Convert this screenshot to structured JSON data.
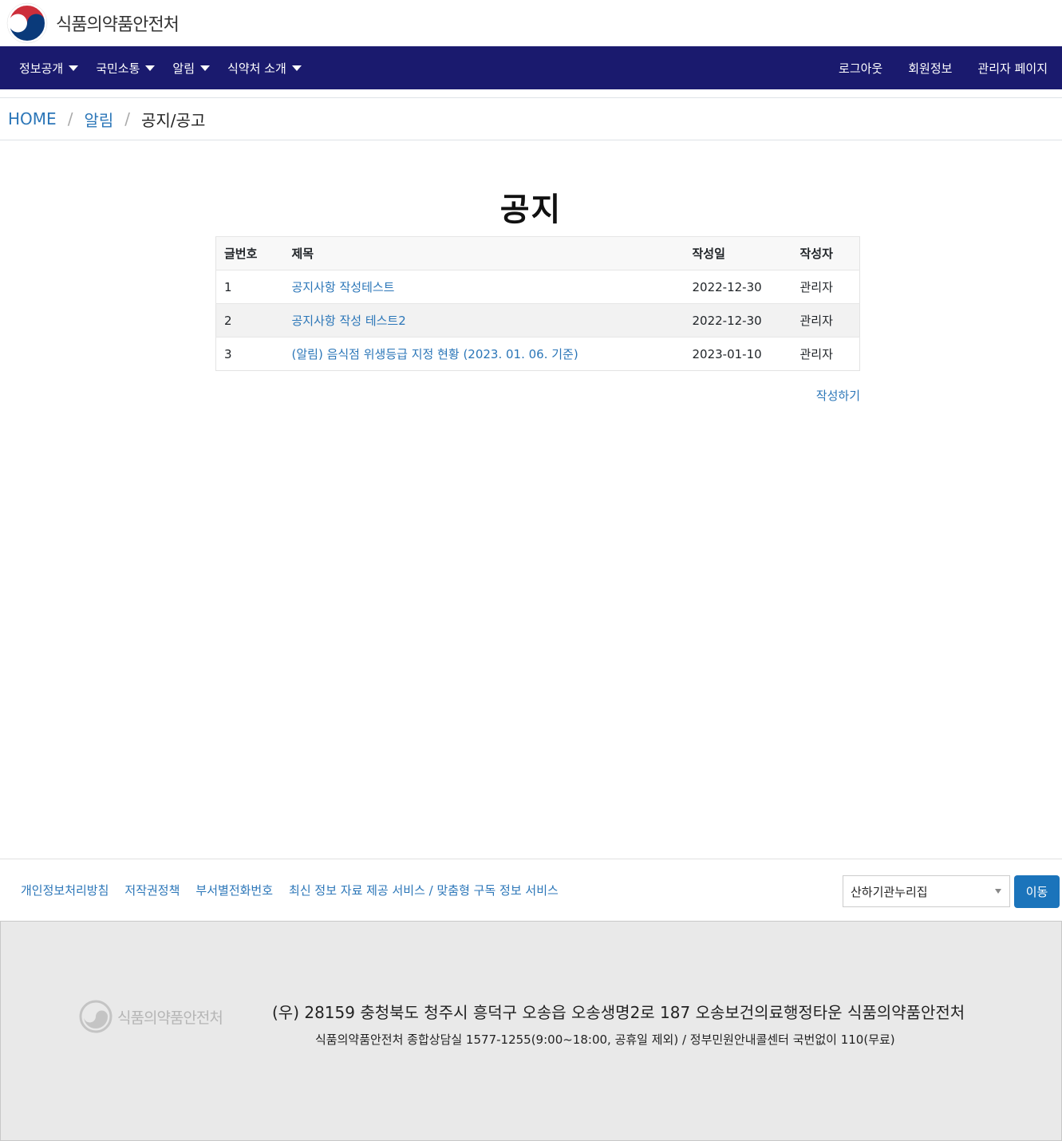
{
  "header": {
    "brand": "식품의약품안전처",
    "nav_left": [
      "정보공개",
      "국민소통",
      "알림",
      "식약처 소개"
    ],
    "nav_right": [
      "로그아웃",
      "회원정보",
      "관리자 페이지"
    ]
  },
  "breadcrumb": {
    "home": "HOME",
    "section": "알림",
    "current": "공지/공고"
  },
  "page": {
    "title": "공지",
    "columns": [
      "글번호",
      "제목",
      "작성일",
      "작성자"
    ],
    "rows": [
      {
        "no": "1",
        "title": "공지사항 작성테스트",
        "date": "2022-12-30",
        "author": "관리자"
      },
      {
        "no": "2",
        "title": "공지사항 작성 테스트2",
        "date": "2022-12-30",
        "author": "관리자"
      },
      {
        "no": "3",
        "title": "(알림) 음식점 위생등급 지정 현황 (2023. 01. 06. 기준)",
        "date": "2023-01-10",
        "author": "관리자"
      }
    ],
    "write_label": "작성하기"
  },
  "footer": {
    "links": [
      "개인정보처리방침",
      "저작권정책",
      "부서별전화번호",
      "최신 정보 자료 제공 서비스 / 맞춤형 구독 정보 서비스"
    ],
    "select_value": "산하기관누리집",
    "go_label": "이동",
    "logo_text": "식품의약품안전처",
    "address": "(우) 28159 충청북도 청주시 흥덕구 오송읍 오송생명2로 187 오송보건의료행정타운 식품의약품안전처",
    "contact": "식품의약품안전처 종합상담실 1577-1255(9:00~18:00, 공휴일 제외) / 정부민원안내콜센터 국번없이 110(무료)"
  },
  "colors": {
    "navbar": "#1a1a6e",
    "link": "#2b76b8",
    "button": "#1b74bb"
  }
}
